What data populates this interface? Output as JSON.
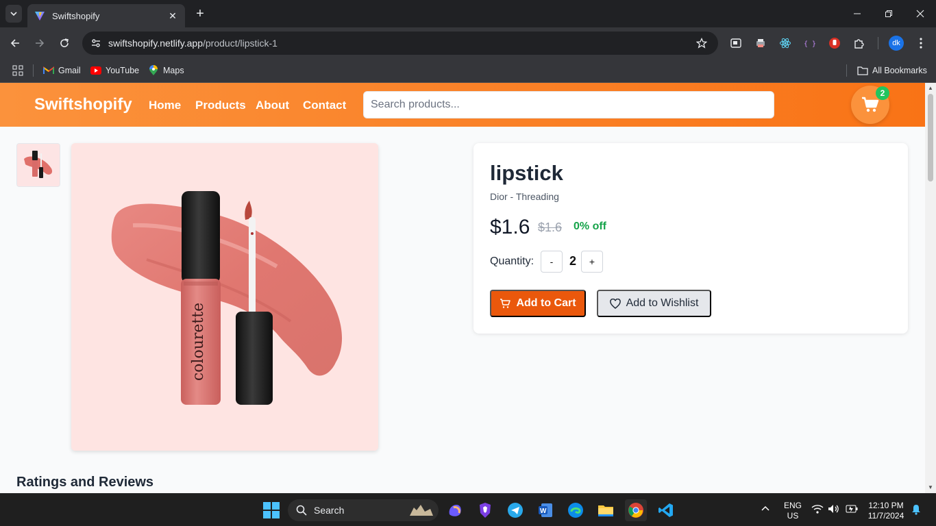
{
  "browser": {
    "tab_title": "Swiftshopify",
    "url_host": "swiftshopify.netlify.app",
    "url_path": "/product/lipstick-1",
    "profile_initials": "dk",
    "bookmarks": [
      {
        "label": "Gmail"
      },
      {
        "label": "YouTube"
      },
      {
        "label": "Maps"
      }
    ],
    "all_bookmarks_label": "All Bookmarks"
  },
  "site": {
    "brand": "Swiftshopify",
    "nav": [
      "Home",
      "Products",
      "About",
      "Contact"
    ],
    "search_placeholder": "Search products...",
    "cart_count": "2",
    "accent_color": "#f97316"
  },
  "product": {
    "name": "lipstick",
    "brand_line": "Dior - Threading",
    "price": "$1.6",
    "original_price": "$1.6",
    "discount": "0% off",
    "quantity_label": "Quantity:",
    "decrement_label": "-",
    "quantity": "2",
    "increment_label": "+",
    "add_to_cart_label": "Add to Cart",
    "add_to_wishlist_label": "Add to Wishlist",
    "image_text": "colourette"
  },
  "reviews": {
    "title": "Ratings and Reviews"
  },
  "taskbar": {
    "search_label": "Search",
    "lang_line1": "ENG",
    "lang_line2": "US",
    "time": "12:10 PM",
    "date": "11/7/2024"
  }
}
